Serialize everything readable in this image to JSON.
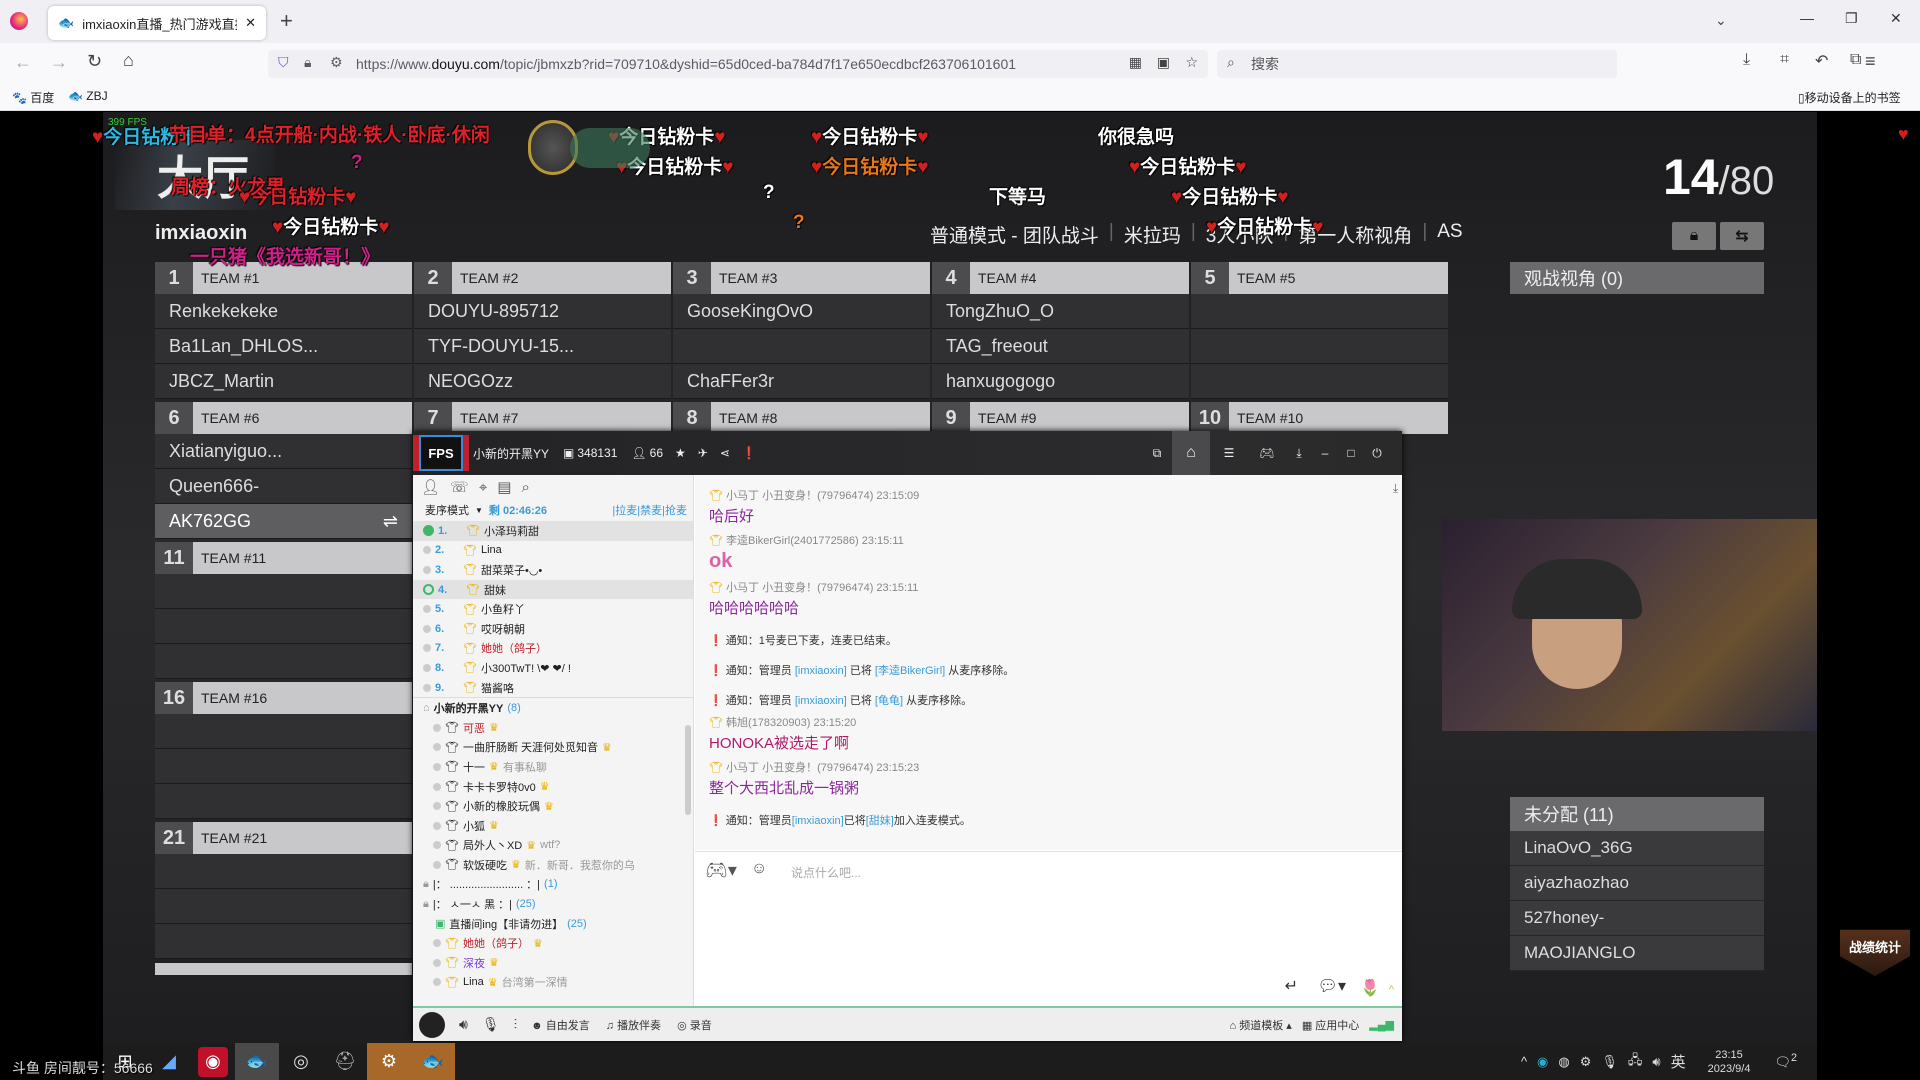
{
  "browser": {
    "tab_title": "imxiaoxin直播_热门游戏直播_",
    "new_tab": "+",
    "url_prefix": "https://www.",
    "url_domain": "douyu.com",
    "url_rest": "/topic/jbmxzb?rid=709710&dyshid=65d0ced-ba784d7f17e650ecdbcf263706101601",
    "search_placeholder": "搜索",
    "bookmarks": [
      "百度",
      "ZBJ"
    ],
    "mobile_bookmarks": "移动设备上的书签"
  },
  "game": {
    "fps": "399 FPS",
    "title": "大厅",
    "streamer": "imxiaoxin",
    "mode_line": [
      "普通模式 - 团队战斗",
      "米拉玛",
      "3人小队",
      "第一人称视角",
      "AS"
    ],
    "count_current": "14",
    "count_total": "/80",
    "teams": [
      {
        "num": "1",
        "name": "TEAM #1",
        "players": [
          "Renkekekeke",
          "Ba1Lan_DHLOS...",
          "JBCZ_Martin"
        ]
      },
      {
        "num": "2",
        "name": "TEAM #2",
        "players": [
          "DOUYU-895712",
          "TYF-DOUYU-15...",
          "NEOGOzz"
        ]
      },
      {
        "num": "3",
        "name": "TEAM #3",
        "players": [
          "GooseKingOvO",
          "",
          "ChaFFer3r"
        ]
      },
      {
        "num": "4",
        "name": "TEAM #4",
        "players": [
          "TongZhuO_O",
          "TAG_freeout",
          "hanxugogogo"
        ]
      },
      {
        "num": "5",
        "name": "TEAM #5",
        "players": [
          "",
          "",
          ""
        ]
      },
      {
        "num": "6",
        "name": "TEAM #6",
        "players": [
          "Xiatianyiguo...",
          "Queen666-",
          "AK762GG"
        ]
      },
      {
        "num": "7",
        "name": "TEAM #7",
        "players": []
      },
      {
        "num": "8",
        "name": "TEAM #8",
        "players": []
      },
      {
        "num": "9",
        "name": "TEAM #9",
        "players": []
      },
      {
        "num": "10",
        "name": "TEAM #10",
        "players": []
      },
      {
        "num": "11",
        "name": "TEAM #11",
        "players": []
      },
      {
        "num": "16",
        "name": "TEAM #16",
        "players": []
      },
      {
        "num": "21",
        "name": "TEAM #21",
        "players": []
      }
    ],
    "spectator": "观战视角 (0)",
    "unassigned": "未分配 (11)",
    "unassigned_players": [
      "LinaOvO_36G",
      "aiyazhaozhao",
      "527honey-",
      "MAOJIANGLO"
    ],
    "stats_logo": "战绩统计"
  },
  "danmaku": [
    {
      "text": "今日钻粉卡",
      "color": "#2fb8e0",
      "hearts": true
    },
    {
      "text": "节目单：4点开船·内战·铁人·卧底·休闲",
      "color": "#e0202a",
      "hearts": false
    },
    {
      "text": "周榜：火龙果",
      "color": "#e0202a",
      "hearts": false
    },
    {
      "text": "今日钻粉卡",
      "color": "#e0202a",
      "hearts": true
    },
    {
      "text": "今日钻粉卡",
      "color": "#ffffff",
      "hearts": true
    },
    {
      "text": "一只猪《我选新哥！》",
      "color": "#d0208a",
      "hearts": false
    },
    {
      "text": "今日钻粉卡",
      "color": "#ffffff",
      "hearts": true
    },
    {
      "text": "今日钻粉卡",
      "color": "#ffffff",
      "hearts": true
    },
    {
      "text": "今日钻粉卡",
      "color": "#ffffff",
      "hearts": true
    },
    {
      "text": "今日钻粉卡",
      "color": "#e8771c",
      "hearts": true
    },
    {
      "text": "你很急吗",
      "color": "#ffffff",
      "hearts": false
    },
    {
      "text": "今日钻粉卡",
      "color": "#ffffff",
      "hearts": true
    },
    {
      "text": "下等马",
      "color": "#ffffff",
      "hearts": false
    },
    {
      "text": "今日钻粉卡",
      "color": "#ffffff",
      "hearts": true
    },
    {
      "text": "今日钻粉卡",
      "color": "#ffffff",
      "hearts": true
    },
    {
      "text": "?",
      "color": "#d0208a",
      "hearts": false
    },
    {
      "text": "?",
      "color": "#ffffff",
      "hearts": false
    },
    {
      "text": "?",
      "color": "#e8771c",
      "hearts": false
    }
  ],
  "yy": {
    "channel": "小新的开黑YY",
    "id": "348131",
    "users": "66",
    "mode": "麦序模式",
    "remaining": "剩 02:46:26",
    "actions": [
      "拉麦",
      "禁麦",
      "抢麦"
    ],
    "queue": [
      {
        "n": "1.",
        "name": "小泽玛莉甜"
      },
      {
        "n": "2.",
        "name": "Lina"
      },
      {
        "n": "3.",
        "name": "甜菜菜子•◡•"
      },
      {
        "n": "4.",
        "name": "甜妹"
      },
      {
        "n": "5.",
        "name": "小鱼籽丫"
      },
      {
        "n": "6.",
        "name": "哎呀朝朝"
      },
      {
        "n": "7.",
        "name": "她她（鸽子）"
      },
      {
        "n": "8.",
        "name": "小300TwT!  \\❤ ❤/ !"
      },
      {
        "n": "9.",
        "name": "猫酱咯"
      }
    ],
    "tree_root": "小新的开黑YY",
    "tree_root_count": "(8)",
    "members": [
      {
        "name": "可恶",
        "note": ""
      },
      {
        "name": "一曲肝肠断 天涯何处觅知音",
        "note": ""
      },
      {
        "name": "十一",
        "note": "有事私聊"
      },
      {
        "name": "卡卡卡罗特0v0",
        "note": ""
      },
      {
        "name": "小新的橡胶玩偶",
        "note": ""
      },
      {
        "name": "小狐",
        "note": ""
      },
      {
        "name": "局外人丶XD",
        "note": "wtf?"
      },
      {
        "name": "软饭硬吃",
        "note": "新．新哥．我惹你的乌"
      }
    ],
    "sub1": "|：  ........................  ：|",
    "sub1_count": "(1)",
    "sub2": "|：      ㅅ一ㅅ    黑      ：|",
    "sub2_count": "(25)",
    "live_room": "直播间ing【非请勿进】",
    "live_room_count": "(25)",
    "live_members": [
      {
        "name": "她她（鸽子）",
        "note": ""
      },
      {
        "name": "深夜",
        "note": ""
      },
      {
        "name": "Lina",
        "note": "台湾第一深情"
      }
    ],
    "chat": [
      {
        "type": "msg",
        "user": "小马丁 小丑变身！(79796474)",
        "time": "23:15:09",
        "text": "哈后好",
        "color": "#8a2a9a"
      },
      {
        "type": "msg",
        "user": "李逵BikerGirl(2401772586)",
        "time": "23:15:11",
        "text": "ok",
        "color": "#e060a8"
      },
      {
        "type": "msg",
        "user": "小马丁 小丑变身！(79796474)",
        "time": "23:15:11",
        "text": "哈哈哈哈哈哈",
        "color": "#8a2a9a"
      },
      {
        "type": "note",
        "text": "通知：1号麦已下麦，连麦已结束。"
      },
      {
        "type": "note",
        "pre": "通知：管理员 ",
        "a": "[imxiaoxin]",
        "mid": " 已将 ",
        "b": "[李逵BikerGirl]",
        "post": " 从麦序移除。"
      },
      {
        "type": "note",
        "pre": "通知：管理员 ",
        "a": "[imxiaoxin]",
        "mid": " 已将 ",
        "b": "[龟龟]",
        "post": " 从麦序移除。"
      },
      {
        "type": "msg",
        "user": "韩旭(178320903)",
        "time": "23:15:20",
        "text": "HONOKA被选走了啊",
        "color": "#b0186a"
      },
      {
        "type": "msg",
        "user": "小马丁 小丑变身！(79796474)",
        "time": "23:15:23",
        "text": "整个大西北乱成一锅粥",
        "color": "#8a2a9a"
      },
      {
        "type": "note",
        "pre": "通知：管理员",
        "a": "[imxiaoxin]",
        "mid": "已将",
        "b": "[甜妹]",
        "post": "加入连麦模式。"
      }
    ],
    "input_placeholder": "说点什么吧...",
    "bottom": {
      "free": "自由发言",
      "music": "播放伴奏",
      "record": "录音",
      "template": "频道模板",
      "apps": "应用中心"
    }
  },
  "overlay": {
    "room_number": "斗鱼 房间靓号：56666",
    "clock_time": "23:15",
    "clock_date": "2023/9/4",
    "ime": "英",
    "notif_count": "2"
  }
}
